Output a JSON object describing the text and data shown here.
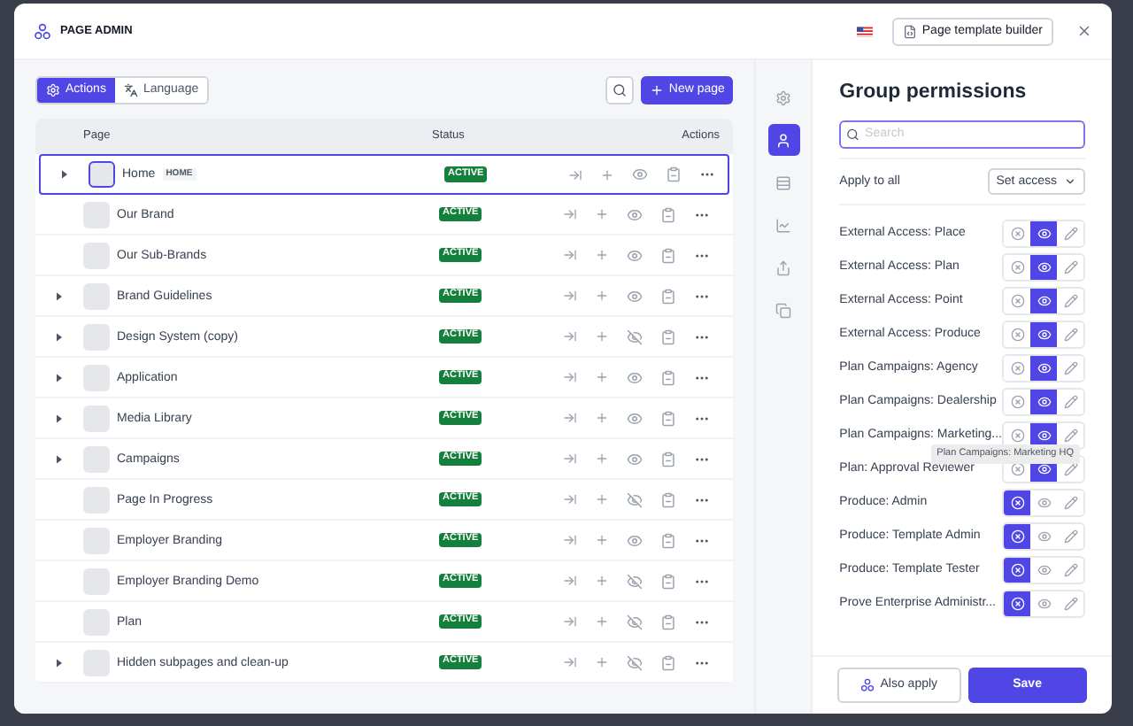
{
  "header": {
    "title": "PAGE ADMIN",
    "template_button": "Page template builder"
  },
  "toolbar": {
    "tabs": [
      {
        "label": "Actions",
        "selected": true
      },
      {
        "label": "Language",
        "selected": false
      }
    ],
    "new_button": "New page"
  },
  "table": {
    "columns": [
      "Page",
      "Status",
      "Actions"
    ],
    "rows": [
      {
        "name": "Home",
        "tag": "HOME",
        "status": "ACTIVE",
        "expandable": true,
        "visible": true,
        "selected": true
      },
      {
        "name": "Our Brand",
        "status": "ACTIVE",
        "expandable": false,
        "visible": true,
        "selected": false
      },
      {
        "name": "Our Sub-Brands",
        "status": "ACTIVE",
        "expandable": false,
        "visible": true,
        "selected": false
      },
      {
        "name": "Brand Guidelines",
        "status": "ACTIVE",
        "expandable": true,
        "visible": true,
        "selected": false
      },
      {
        "name": "Design System (copy)",
        "status": "ACTIVE",
        "expandable": true,
        "visible": false,
        "selected": false
      },
      {
        "name": "Application",
        "status": "ACTIVE",
        "expandable": true,
        "visible": true,
        "selected": false
      },
      {
        "name": "Media Library",
        "status": "ACTIVE",
        "expandable": true,
        "visible": true,
        "selected": false
      },
      {
        "name": "Campaigns",
        "status": "ACTIVE",
        "expandable": true,
        "visible": true,
        "selected": false
      },
      {
        "name": "Page In Progress",
        "status": "ACTIVE",
        "expandable": false,
        "visible": false,
        "selected": false
      },
      {
        "name": "Employer Branding",
        "status": "ACTIVE",
        "expandable": false,
        "visible": true,
        "selected": false
      },
      {
        "name": "Employer Branding Demo",
        "status": "ACTIVE",
        "expandable": false,
        "visible": false,
        "selected": false
      },
      {
        "name": "Plan",
        "status": "ACTIVE",
        "expandable": false,
        "visible": false,
        "selected": false
      },
      {
        "name": "Hidden subpages and clean-up",
        "status": "ACTIVE",
        "expandable": true,
        "visible": false,
        "selected": false
      }
    ]
  },
  "rail": [
    {
      "kind": "settings",
      "selected": false
    },
    {
      "kind": "users",
      "selected": true
    },
    {
      "kind": "rows",
      "selected": false
    },
    {
      "kind": "chart",
      "selected": false
    },
    {
      "kind": "share",
      "selected": false
    },
    {
      "kind": "copy",
      "selected": false
    }
  ],
  "permissions": {
    "title": "Group permissions",
    "search_placeholder": "Search",
    "apply_label": "Apply to all",
    "apply_select": "Set access",
    "groups": [
      {
        "name": "External Access: Place",
        "options": [
          {
            "kind": "none",
            "selected": false
          },
          {
            "kind": "view",
            "selected": true
          },
          {
            "kind": "edit",
            "selected": false
          }
        ]
      },
      {
        "name": "External Access: Plan",
        "options": [
          {
            "kind": "none",
            "selected": false
          },
          {
            "kind": "view",
            "selected": true
          },
          {
            "kind": "edit",
            "selected": false
          }
        ]
      },
      {
        "name": "External Access: Point",
        "options": [
          {
            "kind": "none",
            "selected": false
          },
          {
            "kind": "view",
            "selected": true
          },
          {
            "kind": "edit",
            "selected": false
          }
        ]
      },
      {
        "name": "External Access: Produce",
        "options": [
          {
            "kind": "none",
            "selected": false
          },
          {
            "kind": "view",
            "selected": true
          },
          {
            "kind": "edit",
            "selected": false
          }
        ]
      },
      {
        "name": "Plan Campaigns: Agency",
        "options": [
          {
            "kind": "none",
            "selected": false
          },
          {
            "kind": "view",
            "selected": true
          },
          {
            "kind": "edit",
            "selected": false
          }
        ]
      },
      {
        "name": "Plan Campaigns: Dealership",
        "options": [
          {
            "kind": "none",
            "selected": false
          },
          {
            "kind": "view",
            "selected": true
          },
          {
            "kind": "edit",
            "selected": false
          }
        ]
      },
      {
        "name": "Plan Campaigns: Marketing...",
        "options": [
          {
            "kind": "none",
            "selected": false
          },
          {
            "kind": "view",
            "selected": true
          },
          {
            "kind": "edit",
            "selected": false
          }
        ]
      },
      {
        "name": "Plan: Approval Reviewer",
        "options": [
          {
            "kind": "none",
            "selected": false
          },
          {
            "kind": "view",
            "selected": true
          },
          {
            "kind": "edit",
            "selected": false
          }
        ]
      },
      {
        "name": "Produce: Admin",
        "options": [
          {
            "kind": "none",
            "selected": true
          },
          {
            "kind": "view",
            "selected": false
          },
          {
            "kind": "edit",
            "selected": false
          }
        ]
      },
      {
        "name": "Produce: Template Admin",
        "options": [
          {
            "kind": "none",
            "selected": true
          },
          {
            "kind": "view",
            "selected": false
          },
          {
            "kind": "edit",
            "selected": false
          }
        ]
      },
      {
        "name": "Produce: Template Tester",
        "options": [
          {
            "kind": "none",
            "selected": true
          },
          {
            "kind": "view",
            "selected": false
          },
          {
            "kind": "edit",
            "selected": false
          }
        ]
      },
      {
        "name": "Prove Enterprise Administr...",
        "options": [
          {
            "kind": "none",
            "selected": true
          },
          {
            "kind": "view",
            "selected": false
          },
          {
            "kind": "edit",
            "selected": false
          }
        ]
      }
    ],
    "tooltip": "Plan Campaigns: Marketing HQ",
    "also_apply": "Also apply",
    "save": "Save"
  }
}
